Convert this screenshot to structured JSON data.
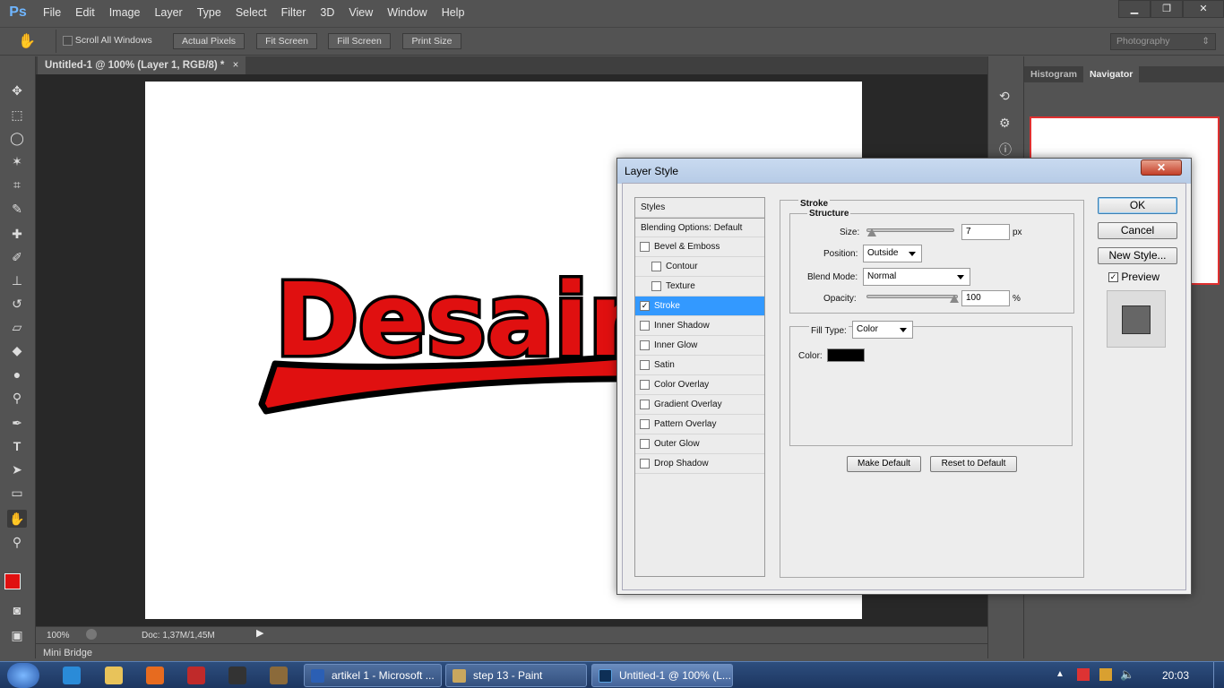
{
  "app": {
    "logo": "Ps"
  },
  "menu": [
    "File",
    "Edit",
    "Image",
    "Layer",
    "Type",
    "Select",
    "Filter",
    "3D",
    "View",
    "Window",
    "Help"
  ],
  "options": {
    "scroll_all": "Scroll All Windows",
    "actual_pixels": "Actual Pixels",
    "fit_screen": "Fit Screen",
    "fill_screen": "Fill Screen",
    "print_size": "Print Size",
    "workspace": "Photography"
  },
  "document": {
    "tab_title": "Untitled-1 @ 100% (Layer 1, RGB/8) *",
    "artwork_text": "Desain"
  },
  "status": {
    "zoom": "100%",
    "doc": "Doc: 1,37M/1,45M"
  },
  "mini_bridge": "Mini Bridge",
  "panels": {
    "histogram": "Histogram",
    "navigator": "Navigator"
  },
  "dialog": {
    "title": "Layer Style",
    "styles_header": "Styles",
    "blending": "Blending Options: Default",
    "styles": [
      {
        "label": "Bevel & Emboss",
        "checked": false
      },
      {
        "label": "Contour",
        "checked": false,
        "indent": true
      },
      {
        "label": "Texture",
        "checked": false,
        "indent": true
      },
      {
        "label": "Stroke",
        "checked": true,
        "selected": true
      },
      {
        "label": "Inner Shadow",
        "checked": false
      },
      {
        "label": "Inner Glow",
        "checked": false
      },
      {
        "label": "Satin",
        "checked": false
      },
      {
        "label": "Color Overlay",
        "checked": false
      },
      {
        "label": "Gradient Overlay",
        "checked": false
      },
      {
        "label": "Pattern Overlay",
        "checked": false
      },
      {
        "label": "Outer Glow",
        "checked": false
      },
      {
        "label": "Drop Shadow",
        "checked": false
      }
    ],
    "section": "Stroke",
    "structure": "Structure",
    "size_label": "Size:",
    "size_value": "7",
    "size_unit": "px",
    "position_label": "Position:",
    "position_value": "Outside",
    "blend_label": "Blend Mode:",
    "blend_value": "Normal",
    "opacity_label": "Opacity:",
    "opacity_value": "100",
    "opacity_unit": "%",
    "fill_type_label": "Fill Type:",
    "fill_type_value": "Color",
    "color_label": "Color:",
    "color_value": "#000000",
    "make_default": "Make Default",
    "reset_default": "Reset to Default",
    "ok": "OK",
    "cancel": "Cancel",
    "new_style": "New Style...",
    "preview": "Preview"
  },
  "taskbar": {
    "items": [
      "artikel 1 - Microsoft ...",
      "step 13 - Paint",
      "Untitled-1 @ 100% (L..."
    ],
    "clock": "20:03"
  },
  "colors": {
    "foreground": "#e01010",
    "background": "#ffffff",
    "accent": "#3399ff"
  }
}
